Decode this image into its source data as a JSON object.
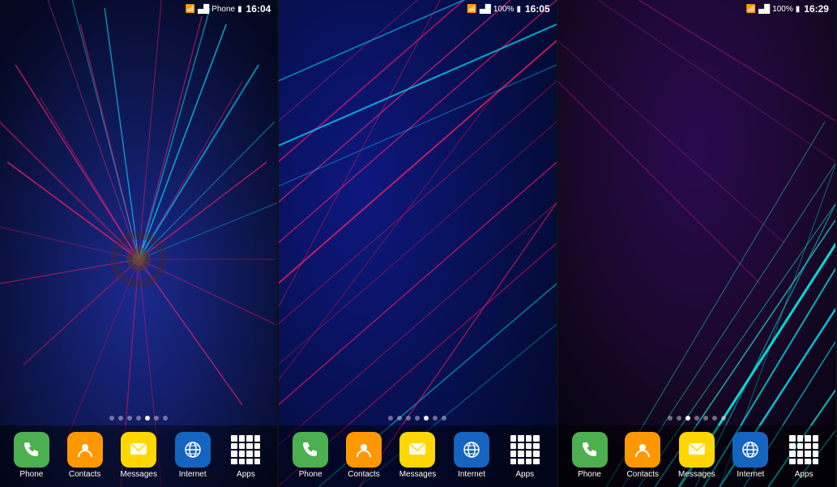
{
  "screens": [
    {
      "id": "screen1",
      "time": "16:04",
      "wallpaper_style": "vortex",
      "bg_color1": "#0a1a6e",
      "bg_color2": "#0d0a4a",
      "dots": [
        false,
        false,
        false,
        false,
        true,
        false,
        false
      ],
      "dock": {
        "apps": [
          {
            "name": "Phone",
            "icon": "phone",
            "color": "#4caf50"
          },
          {
            "name": "Contacts",
            "icon": "contacts",
            "color": "#ff9800"
          },
          {
            "name": "Messages",
            "icon": "messages",
            "color": "#ffd600"
          },
          {
            "name": "Internet",
            "icon": "internet",
            "color": "#1565c0"
          },
          {
            "name": "Apps",
            "icon": "apps",
            "color": "transparent"
          }
        ]
      }
    },
    {
      "id": "screen2",
      "time": "16:05",
      "wallpaper_style": "diagonal",
      "bg_color1": "#091060",
      "bg_color2": "#060c50",
      "dots": [
        false,
        false,
        false,
        false,
        true,
        false,
        false
      ],
      "dock": {
        "apps": [
          {
            "name": "Phone",
            "icon": "phone",
            "color": "#4caf50"
          },
          {
            "name": "Contacts",
            "icon": "contacts",
            "color": "#ff9800"
          },
          {
            "name": "Messages",
            "icon": "messages",
            "color": "#ffd600"
          },
          {
            "name": "Internet",
            "icon": "internet",
            "color": "#1565c0"
          },
          {
            "name": "Apps",
            "icon": "apps",
            "color": "transparent"
          }
        ]
      }
    },
    {
      "id": "screen3",
      "time": "16:29",
      "wallpaper_style": "diagonal2",
      "bg_color1": "#1a0a3a",
      "bg_color2": "#0d0820",
      "dots": [
        false,
        false,
        true,
        false,
        false,
        false,
        false
      ],
      "dock": {
        "apps": [
          {
            "name": "Phone",
            "icon": "phone",
            "color": "#4caf50"
          },
          {
            "name": "Contacts",
            "icon": "contacts",
            "color": "#ff9800"
          },
          {
            "name": "Messages",
            "icon": "messages",
            "color": "#ffd600"
          },
          {
            "name": "Internet",
            "icon": "internet",
            "color": "#1565c0"
          },
          {
            "name": "Apps",
            "icon": "apps",
            "color": "transparent"
          }
        ]
      }
    }
  ],
  "status": {
    "signal_icon": "▲",
    "wifi_icon": "wifi",
    "battery_icon": "🔋",
    "battery_pct": "100%"
  }
}
